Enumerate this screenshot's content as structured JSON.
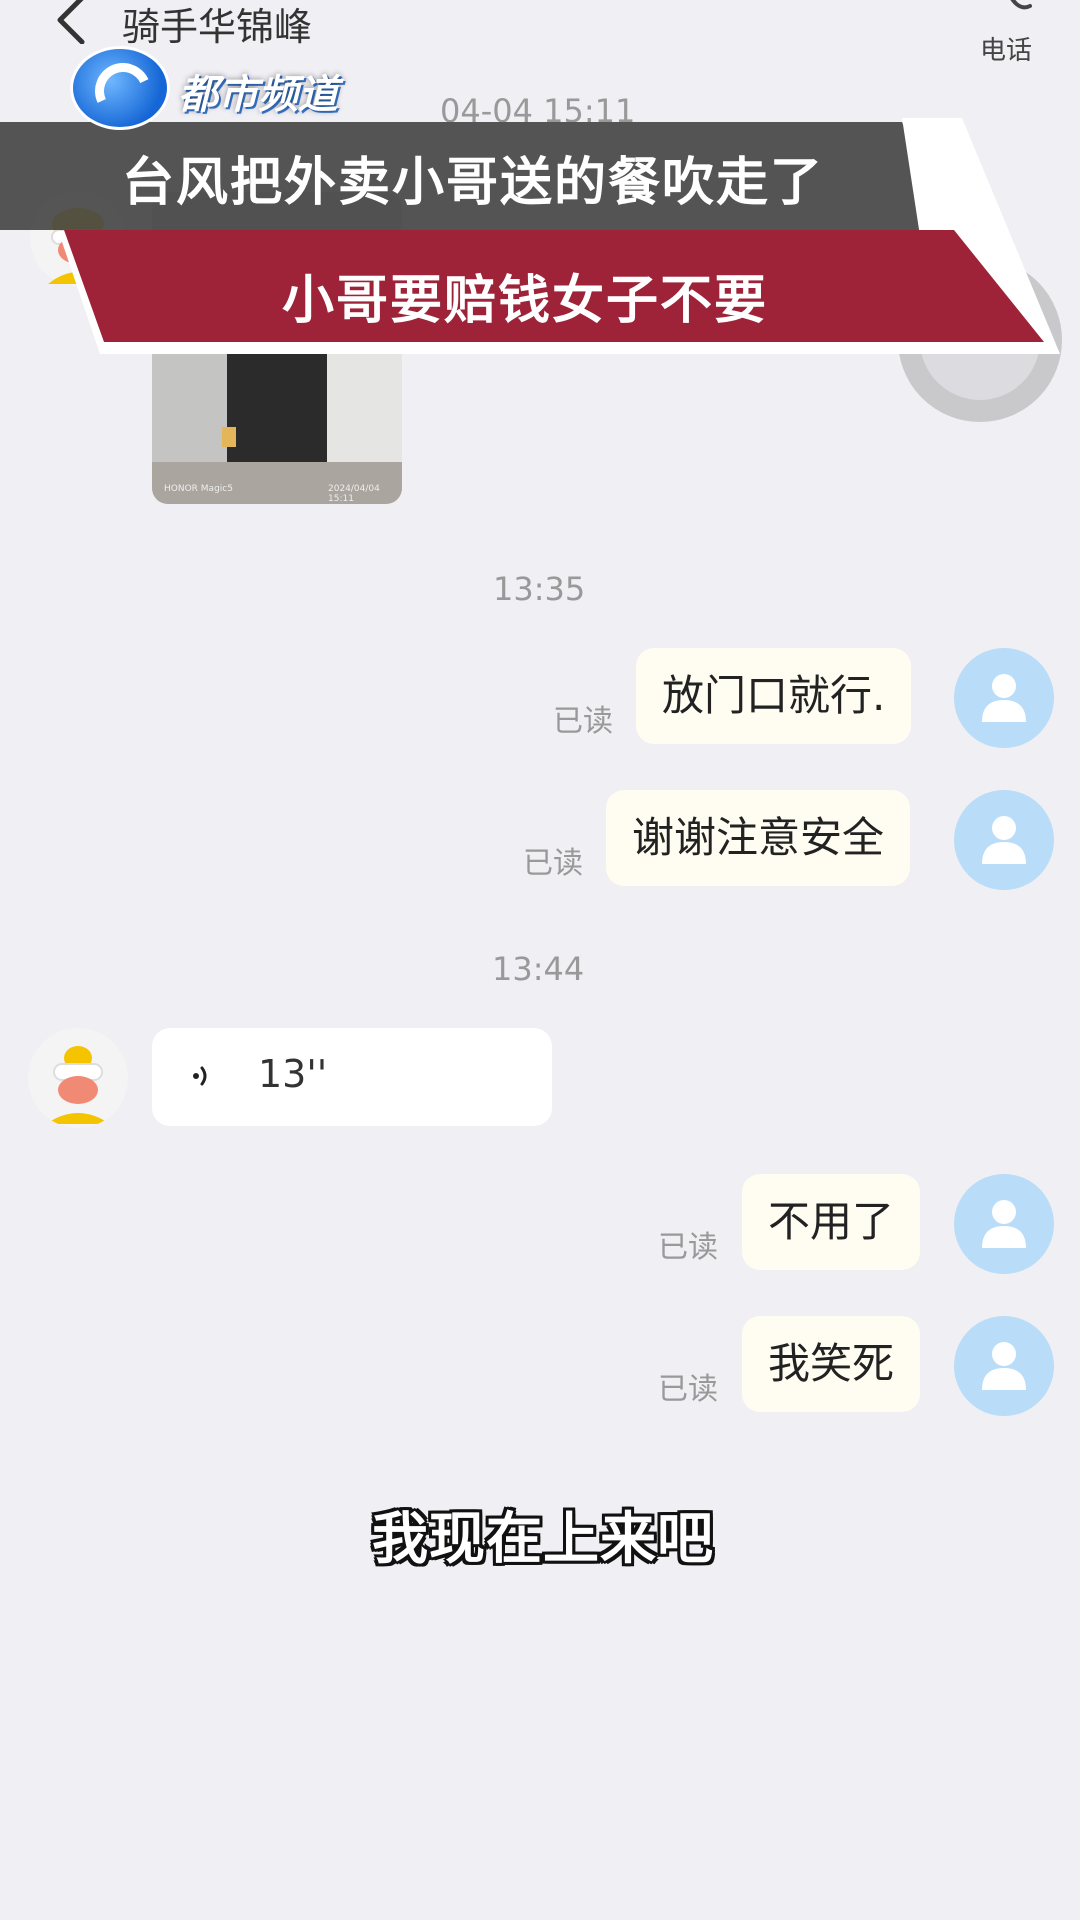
{
  "header": {
    "contact_name": "骑手华锦峰",
    "phone_label": "电话"
  },
  "overlay": {
    "channel_name": "都市频道",
    "headline_line1": "台风把外卖小哥送的餐吹走了",
    "headline_line2": "小哥要赔钱女子不要",
    "subtitle": "我现在上来吧"
  },
  "chat": {
    "time_top": "04-04 15:11",
    "photo": {
      "brand": "HONOR Magic5",
      "stamp": "2024/04/04 15:11"
    },
    "group1_time": "13:35",
    "group1_messages": [
      {
        "text": "放门口就行.",
        "status": "已读"
      },
      {
        "text": "谢谢注意安全",
        "status": "已读"
      }
    ],
    "group2_time": "13:44",
    "voice_message": {
      "duration": "13''"
    },
    "group2_messages": [
      {
        "text": "不用了",
        "status": "已读"
      },
      {
        "text": "我笑死",
        "status": "已读"
      }
    ]
  },
  "colors": {
    "background": "#efeff4",
    "outgoing_bubble": "#fffdf2",
    "avatar_blue": "#b9dcf8",
    "banner_red": "#9e2338",
    "banner_gray": "#464646"
  },
  "icons": {
    "back": "chevron-left-icon",
    "phone": "phone-icon",
    "voice": "voice-wave-icon",
    "avatar": "person-icon"
  }
}
